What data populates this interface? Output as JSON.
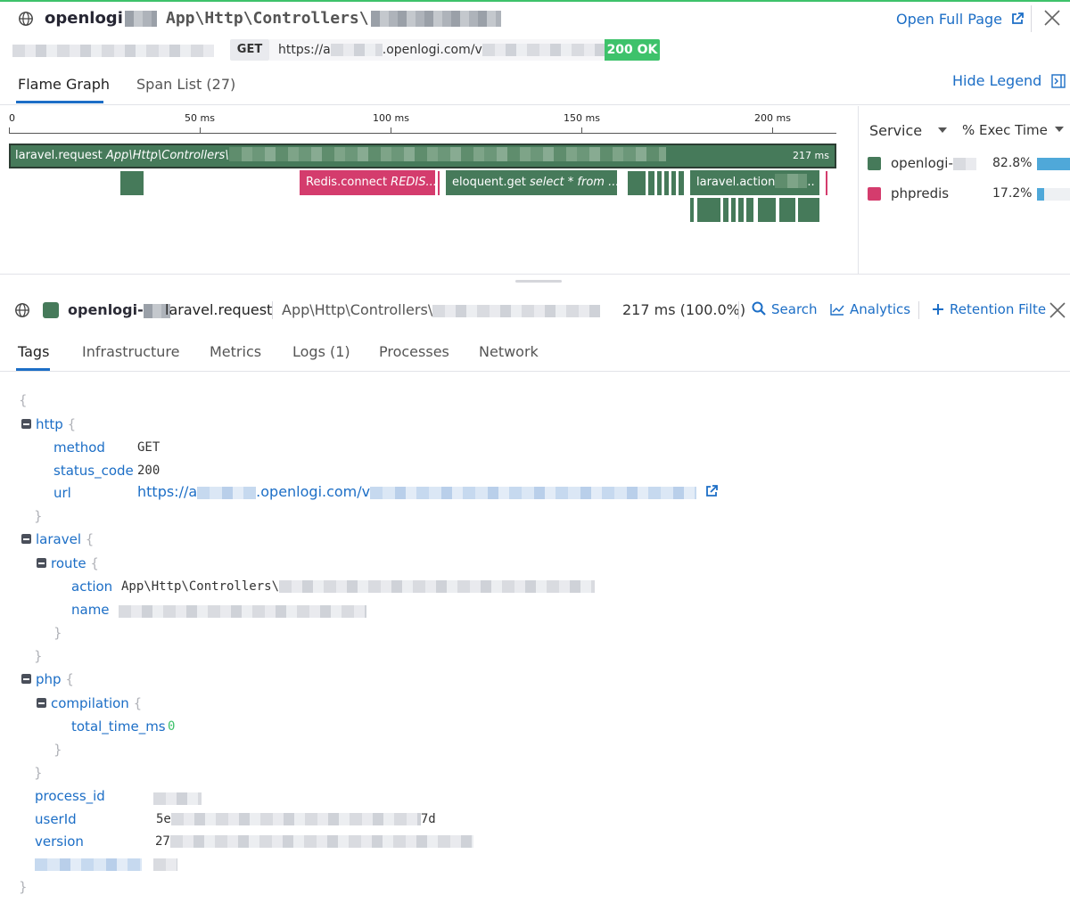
{
  "header": {
    "service": "openlogi",
    "resource": "App\\Http\\Controllers\\",
    "open_full_page": "Open Full Page",
    "method": "GET",
    "url": "https://a",
    "url_host": ".openlogi.com/v",
    "status": "200 OK"
  },
  "top_tabs": [
    {
      "label": "Flame Graph",
      "active": true
    },
    {
      "label": "Span List (27)",
      "active": false
    }
  ],
  "hide_legend": "Hide Legend",
  "flame": {
    "ticks": [
      "0",
      "50 ms",
      "100 ms",
      "150 ms",
      "200 ms"
    ],
    "root_label": "laravel.request ",
    "root_resource": "App\\Http\\Controllers\\",
    "root_duration": "217 ms",
    "redis_op": "Redis.connect ",
    "redis_res": "REDIS...",
    "eloquent_op": "eloquent.get ",
    "eloquent_res": "select * from ...",
    "action_op": "laravel.action",
    "action_tail": ".."
  },
  "legend": {
    "service_header": "Service",
    "exec_header": "% Exec Time",
    "rows": [
      {
        "name": "openlogi-",
        "pct": "82.8%",
        "fill": 0.828,
        "color": "#467a5a"
      },
      {
        "name": "phpredis",
        "pct": "17.2%",
        "fill": 0.172,
        "color": "#d43c6d"
      }
    ]
  },
  "span": {
    "service": "openlogi-",
    "operation": "laravel.request",
    "resource": "App\\Http\\Controllers\\",
    "duration": "217 ms (100.0%)",
    "search": "Search",
    "analytics": "Analytics",
    "retention": "Retention Filte"
  },
  "detail_tabs": [
    {
      "label": "Tags",
      "active": true
    },
    {
      "label": "Infrastructure",
      "active": false
    },
    {
      "label": "Metrics",
      "active": false
    },
    {
      "label": "Logs (1)",
      "active": false
    },
    {
      "label": "Processes",
      "active": false
    },
    {
      "label": "Network",
      "active": false
    }
  ],
  "tags": {
    "open_brace": "{",
    "close_brace": "}",
    "http_key": "http",
    "method_key": "method",
    "method_val": "GET",
    "status_key": "status_code",
    "status_val": "200",
    "url_key": "url",
    "url_val": "https://a",
    "url_host": ".openlogi.com/v",
    "laravel_key": "laravel",
    "route_key": "route",
    "action_key": "action",
    "action_val": "App\\Http\\Controllers\\",
    "name_key": "name",
    "php_key": "php",
    "compilation_key": "compilation",
    "total_time_key": "total_time_ms",
    "total_time_val": "0",
    "process_id_key": "process_id",
    "userid_key": "userId",
    "userid_val_start": "5e",
    "userid_val_end": "7d",
    "version_key": "version",
    "version_val_start": "27"
  }
}
